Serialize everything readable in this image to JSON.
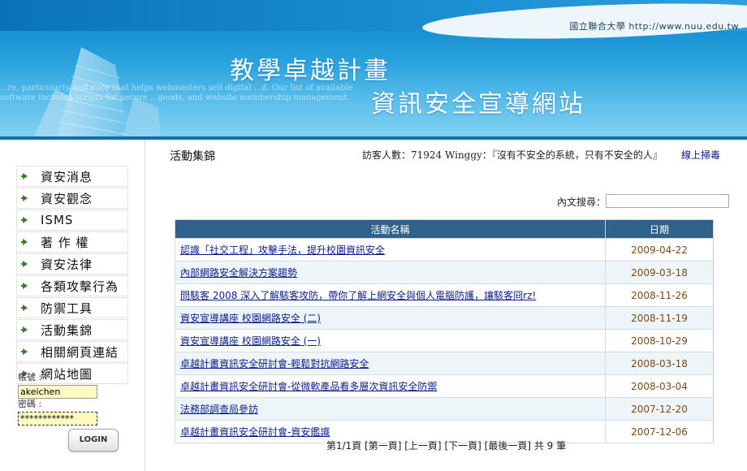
{
  "banner": {
    "university": "國立聯合大學  http://www.nuu.edu.tw",
    "title_line1": "教學卓越計畫",
    "title_line2": "資訊安全宣導網站",
    "faint_text": "...re, particularly, software that helps webmasters sell digital ...d. Our list of available software includes scripts for secure ...goods, and website membership management."
  },
  "sidebar": {
    "items": [
      {
        "label": "資安消息"
      },
      {
        "label": "資安觀念"
      },
      {
        "label": "ISMS"
      },
      {
        "label": "著 作 權"
      },
      {
        "label": "資安法律"
      },
      {
        "label": "各類攻擊行為"
      },
      {
        "label": "防禦工具"
      },
      {
        "label": "活動集錦"
      },
      {
        "label": "相關網頁連結"
      },
      {
        "label": "網站地圖"
      }
    ],
    "login": {
      "account_label": "帳號 :",
      "account_value": "akeichen",
      "password_label": "密碼 :",
      "password_value": "************",
      "button_label": "LOGIN"
    }
  },
  "main": {
    "page_title": "活動集錦",
    "visitors": "訪客人數：71924    Winggy：『沒有不安全的系統，只有不安全的人』",
    "scan_link": "線上掃毒",
    "search_label": "內文搜尋：",
    "search_value": "",
    "table": {
      "headers": [
        "活動名稱",
        "日期"
      ],
      "rows": [
        {
          "name": "認識「社交工程」攻擊手法，提升校園資訊安全",
          "date": "2009-04-22"
        },
        {
          "name": "內部網路安全解決方案趨勢",
          "date": "2009-03-18"
        },
        {
          "name": "問駭客 2008 深入了解駭客攻防，帶你了解上網安全與個人電腦防護，讓駭客冏rz!",
          "date": "2008-11-26"
        },
        {
          "name": "資安宣導講座 校園網路安全 (二)",
          "date": "2008-11-19"
        },
        {
          "name": "資安宣導講座 校園網路安全 (一)",
          "date": "2008-10-29"
        },
        {
          "name": "卓越計畫資訊安全研討會-輕鬆對抗網路安全",
          "date": "2008-03-18"
        },
        {
          "name": "卓越計畫資訊安全研討會-從微軟產品看多層次資訊安全防禦",
          "date": "2008-03-04"
        },
        {
          "name": "法務部調查局參訪",
          "date": "2007-12-20"
        },
        {
          "name": "卓越計畫資訊安全研討會-資安鑑識",
          "date": "2007-12-06"
        }
      ]
    },
    "pager": {
      "page_info": "第1/1頁",
      "first": "[第一頁]",
      "prev": "[上一頁]",
      "next": "[下一頁]",
      "last": "[最後一頁]",
      "total": "共 9 筆"
    }
  },
  "colors": {
    "accent": "#2f6189",
    "link": "#10208a",
    "date": "#7a4a1a",
    "banner": "#29a3de"
  }
}
